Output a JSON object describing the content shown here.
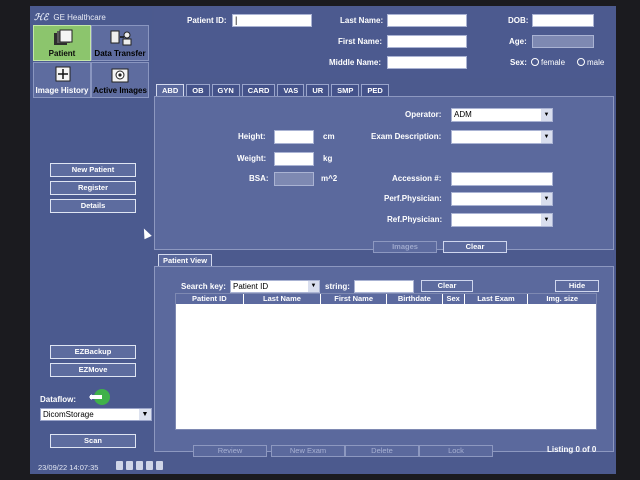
{
  "branding": {
    "logo_mark": "ℋℰ",
    "brand": "GE Healthcare"
  },
  "nav": {
    "tiles": [
      "Patient",
      "Data Transfer",
      "Image History",
      "Active Images"
    ],
    "buttons": [
      "New Patient",
      "Register",
      "Details"
    ],
    "lower_buttons": [
      "EZBackup",
      "EZMove"
    ],
    "dataflow_label": "Dataflow:",
    "dataflow_value": "DicomStorage",
    "scan_label": "Scan"
  },
  "patient": {
    "patient_id_label": "Patient ID:",
    "patient_id_value": "|",
    "last_name_label": "Last Name:",
    "first_name_label": "First Name:",
    "middle_name_label": "Middle Name:",
    "dob_label": "DOB:",
    "age_label": "Age:",
    "sex_label": "Sex:",
    "female_label": "female",
    "male_label": "male"
  },
  "exam": {
    "tabs": [
      "ABD",
      "OB",
      "GYN",
      "CARD",
      "VAS",
      "UR",
      "SMP",
      "PED"
    ],
    "active_tab": "ABD",
    "height_label": "Height:",
    "height_unit": "cm",
    "weight_label": "Weight:",
    "weight_unit": "kg",
    "bsa_label": "BSA:",
    "bsa_unit": "m^2",
    "operator_label": "Operator:",
    "operator_value": "ADM",
    "exam_desc_label": "Exam Description:",
    "accession_label": "Accession #:",
    "perf_physician_label": "Perf.Physician:",
    "ref_physician_label": "Ref.Physician:",
    "images_button": "Images",
    "clear_button": "Clear"
  },
  "patient_view": {
    "tab_label": "Patient View",
    "search_key_label": "Search key:",
    "search_key_value": "Patient ID",
    "string_label": "string:",
    "clear_button": "Clear",
    "hide_button": "Hide",
    "columns": [
      "Patient ID",
      "Last Name",
      "First Name",
      "Birthdate",
      "Sex",
      "Last Exam",
      "Img. size"
    ],
    "bottom_buttons": [
      "Review",
      "New Exam",
      "Delete",
      "Lock"
    ],
    "listing": "Listing 0 of 0"
  },
  "status": {
    "datetime": "23/09/22 14:07:35"
  },
  "colors": {
    "active_tile": "#8cc56d",
    "panel": "#4c5a8e",
    "accent_green": "#3fb14a"
  }
}
